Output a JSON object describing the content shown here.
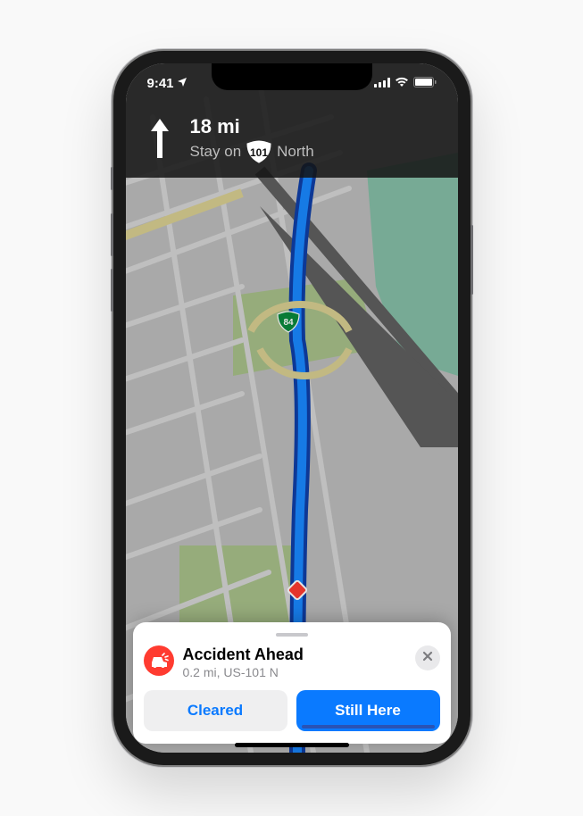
{
  "status_bar": {
    "time": "9:41"
  },
  "navigation": {
    "distance": "18 mi",
    "pre_text": "Stay on",
    "route_number": "101",
    "post_text": "North"
  },
  "map": {
    "interchange_shield_number": "84"
  },
  "alert": {
    "title": "Accident Ahead",
    "subtitle": "0.2 mi, US-101 N",
    "cleared_label": "Cleared",
    "still_here_label": "Still Here"
  }
}
